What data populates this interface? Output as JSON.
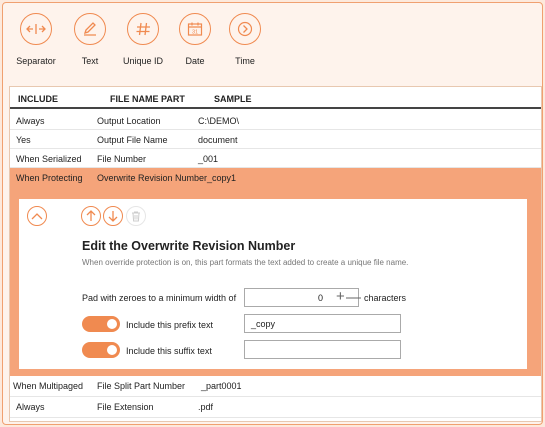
{
  "toolbar": {
    "buttons": [
      {
        "label": "Separator",
        "icon": "separator-icon"
      },
      {
        "label": "Text",
        "icon": "pencil-icon"
      },
      {
        "label": "Unique ID",
        "icon": "hash-icon"
      },
      {
        "label": "Date",
        "icon": "calendar-icon"
      },
      {
        "label": "Time",
        "icon": "chevron-right-icon"
      }
    ],
    "date_icon_text": "31"
  },
  "table": {
    "headers": [
      "INCLUDE",
      "FILE NAME PART",
      "SAMPLE"
    ],
    "rows": [
      {
        "include": "Always",
        "part": "Output Location",
        "sample": "C:\\DEMO\\"
      },
      {
        "include": "Yes",
        "part": "Output File Name",
        "sample": "document"
      },
      {
        "include": "When Serialized",
        "part": "File Number",
        "sample": "_001"
      },
      {
        "include": "When Protecting",
        "part": "Overwrite Revision Number",
        "sample": "_copy1"
      },
      {
        "include": "When Multipaged",
        "part": "File Split Part Number",
        "sample": "_part0001"
      },
      {
        "include": "Always",
        "part": "File Extension",
        "sample": ".pdf"
      }
    ]
  },
  "editor": {
    "title": "Edit the Overwrite Revision Number",
    "description": "When override protection is on, this part formats the text added to create a unique file name.",
    "pad_label": "Pad with zeroes to a minimum width of",
    "pad_value": "0",
    "pad_unit": "characters",
    "prefix_label": "Include this prefix text",
    "prefix_value": "_copy",
    "prefix_enabled": true,
    "suffix_label": "Include this suffix text",
    "suffix_value": "",
    "suffix_enabled": true
  },
  "colors": {
    "accent": "#f08a50",
    "selected_row": "#f5a47a"
  }
}
